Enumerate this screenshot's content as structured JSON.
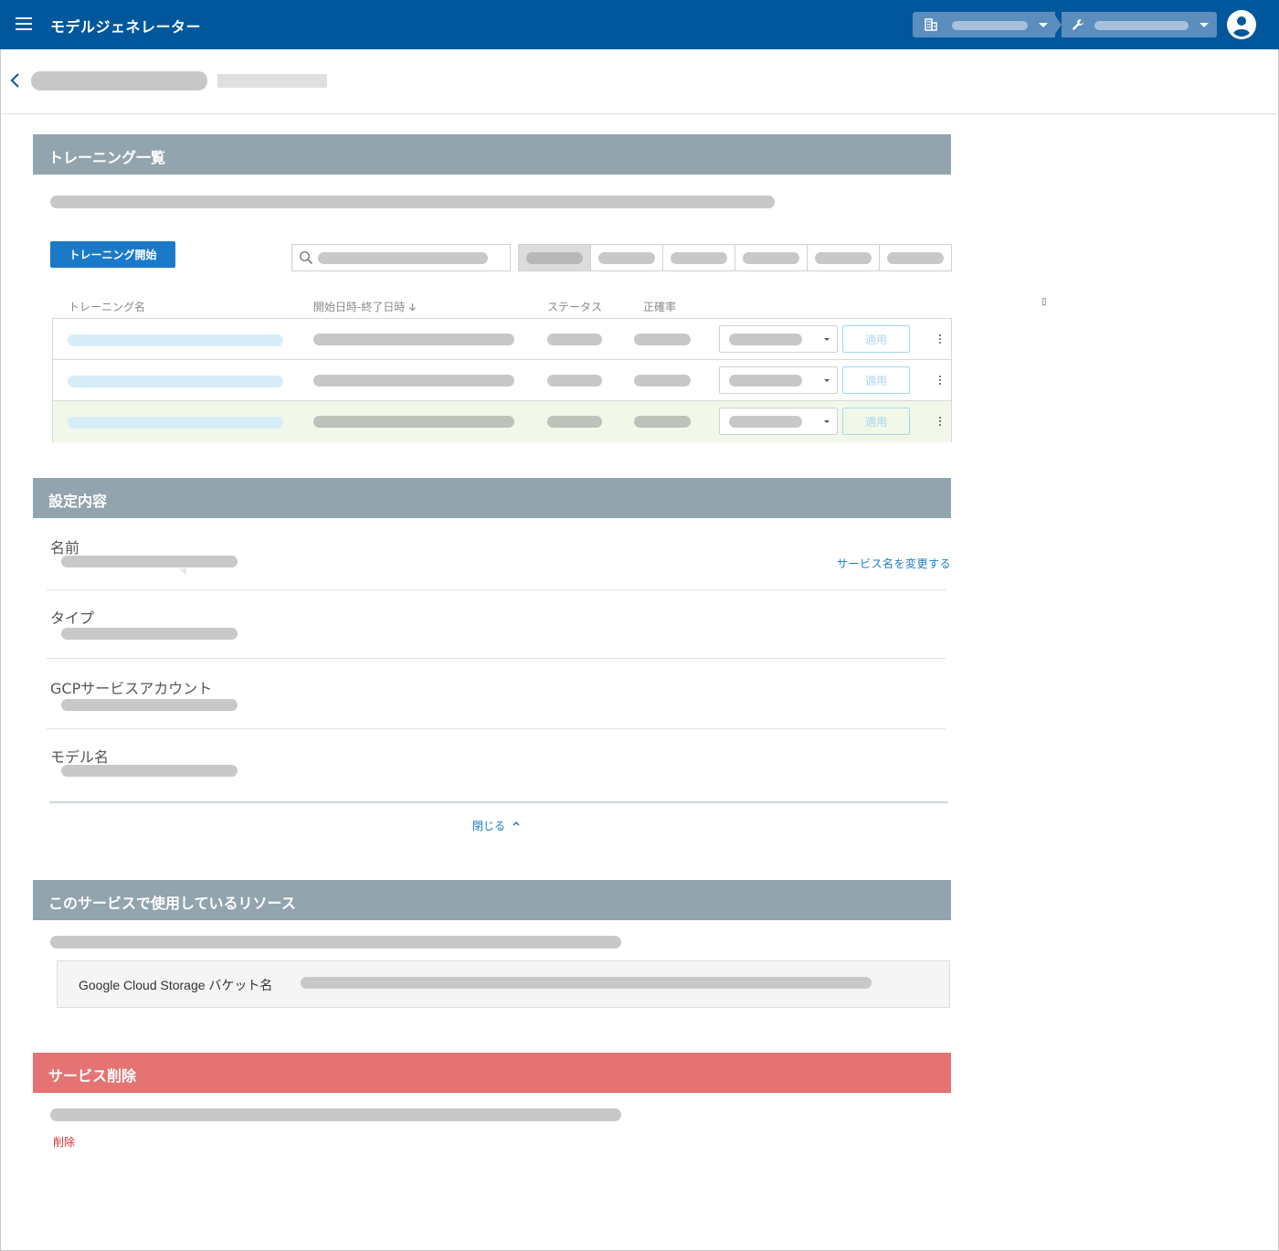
{
  "app": {
    "title": "モデルジェネレーター"
  },
  "icons": {
    "menu": "hamburger-menu-icon",
    "organization": "building-icon",
    "project": "wrench-icon",
    "account": "account-circle-icon",
    "back": "chevron-left-icon",
    "search": "search-icon",
    "sort": "arrow-down-icon",
    "more": "more-vertical-icon",
    "collapse": "chevron-up-icon"
  },
  "colors": {
    "topbar": "#00579c",
    "section_header": "#92a4ad",
    "danger_header": "#e57373",
    "primary": "#1a7ac8",
    "danger": "#d32f2f",
    "highlight_row": "#f1f8e9"
  },
  "training": {
    "section_title": "トレーニング一覧",
    "start_button": "トレーニング開始",
    "filter_count": 6,
    "active_filter_index": 0,
    "columns": {
      "name": "トレーニング名",
      "datetime": "開始日時-終了日時",
      "status": "ステータス",
      "accuracy": "正確率"
    },
    "rows": [
      {
        "highlighted": false,
        "apply_label": "適用"
      },
      {
        "highlighted": false,
        "apply_label": "適用"
      },
      {
        "highlighted": true,
        "apply_label": "適用"
      }
    ]
  },
  "settings": {
    "section_title": "設定内容",
    "fields": [
      {
        "label": "名前"
      },
      {
        "label": "タイプ"
      },
      {
        "label": "GCPサービスアカウント"
      },
      {
        "label": "モデル名"
      }
    ],
    "rename_link": "サービス名を変更する",
    "close_link": "閉じる"
  },
  "resources": {
    "section_title": "このサービスで使用しているリソース",
    "bucket_label": "Google Cloud Storage バケット名"
  },
  "delete": {
    "section_title": "サービス削除",
    "delete_link": "削除"
  },
  "misc": {
    "tiny_glyph": "▯"
  }
}
